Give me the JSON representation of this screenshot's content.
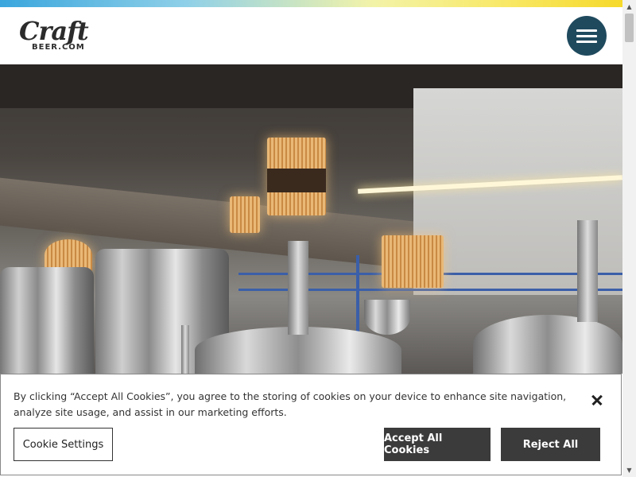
{
  "header": {
    "logo_script": "Craft",
    "logo_sub": "BEER.COM",
    "menu_icon": "hamburger-menu-icon"
  },
  "cookie_banner": {
    "text": "By clicking “Accept All Cookies”, you agree to the storing of cookies on your device to enhance site navigation, analyze site usage, and assist in our marketing efforts.",
    "settings_label": "Cookie Settings",
    "accept_label": "Accept All Cookies",
    "reject_label": "Reject All",
    "close_icon": "close-icon"
  },
  "colors": {
    "menu_button": "#1f4a5e",
    "cookie_buttons": "#3b3b3b"
  }
}
